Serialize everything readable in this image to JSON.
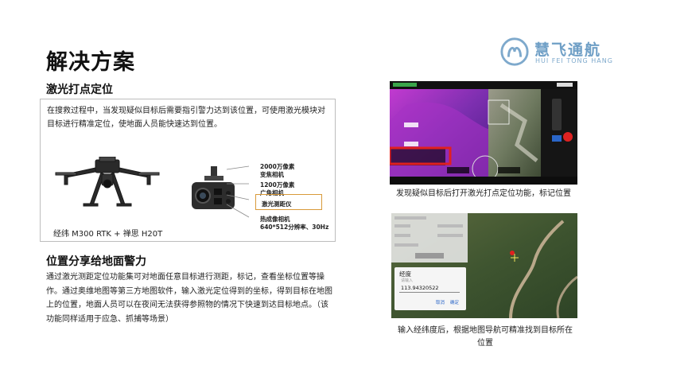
{
  "slide": {
    "title": "解决方案"
  },
  "logo": {
    "name_cn": "慧飞通航",
    "name_en": "HUI FEI TONG HANG"
  },
  "section1": {
    "heading": "激光打点定位",
    "description": "在搜救过程中，当发现疑似目标后需要指引警力达到该位置，可使用激光模块对目标进行精准定位，使地面人员能快速达到位置。",
    "drone_caption": "经纬 M300 RTK + 禅思 H20T",
    "specs": {
      "zoom": "2000万像素\n变焦相机",
      "wide": "1200万像素\n广角相机",
      "laser": "激光测距仪",
      "thermal_name": "热成像相机",
      "thermal_res": "640*512分辨率、30Hz"
    }
  },
  "section2": {
    "heading": "位置分享给地面警力",
    "description": "通过激光测距定位功能集可对地面任意目标进行测距，标记，查看坐标位置等操作。通过奥维地图等第三方地图软件，输入激光定位得到的坐标，得到目标在地图上的位置，地面人员可以在夜间无法获得参照物的情况下快速到达目标地点。（该功能同样适用于应急、抓捕等场景）"
  },
  "screenshot1": {
    "caption": "发现疑似目标后打开激光打点定位功能，标记位置"
  },
  "screenshot2": {
    "caption": "输入经纬度后，根据地图导航可精准找到目标所在位置",
    "dialog_title": "经度",
    "dialog_hint": "请输入",
    "dialog_value": "113.94320522",
    "dialog_cancel": "取消",
    "dialog_ok": "确定"
  },
  "colors": {
    "logo": "#6f9fc6",
    "highlight_red": "#e0201f",
    "spec_box": "#d89a3a",
    "thermal_purple": "#7d2fb0"
  }
}
